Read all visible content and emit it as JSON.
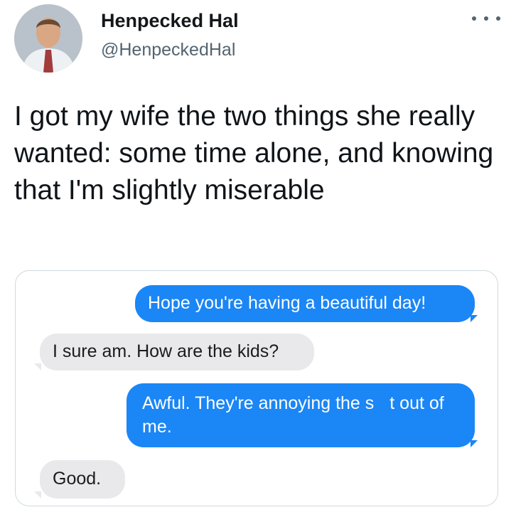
{
  "author": {
    "name": "Henpecked Hal",
    "handle": "@HenpeckedHal"
  },
  "tweet": {
    "text": "I got my wife the two things she really wanted: some time alone, and knowing that I'm slightly miserable"
  },
  "messages": [
    {
      "direction": "outgoing",
      "text": "Hope you're having a beautiful day!"
    },
    {
      "direction": "incoming",
      "text": "I sure am. How are the kids?"
    },
    {
      "direction": "outgoing",
      "text_before": "Awful. They're annoying the s",
      "text_after": "t out of me."
    },
    {
      "direction": "incoming",
      "text": "Good."
    }
  ],
  "colors": {
    "outgoing_bubble": "#1b86f5",
    "incoming_bubble": "#e9e9eb",
    "secondary_text": "#536471"
  },
  "icons": {
    "more": "more-horizontal-icon"
  }
}
